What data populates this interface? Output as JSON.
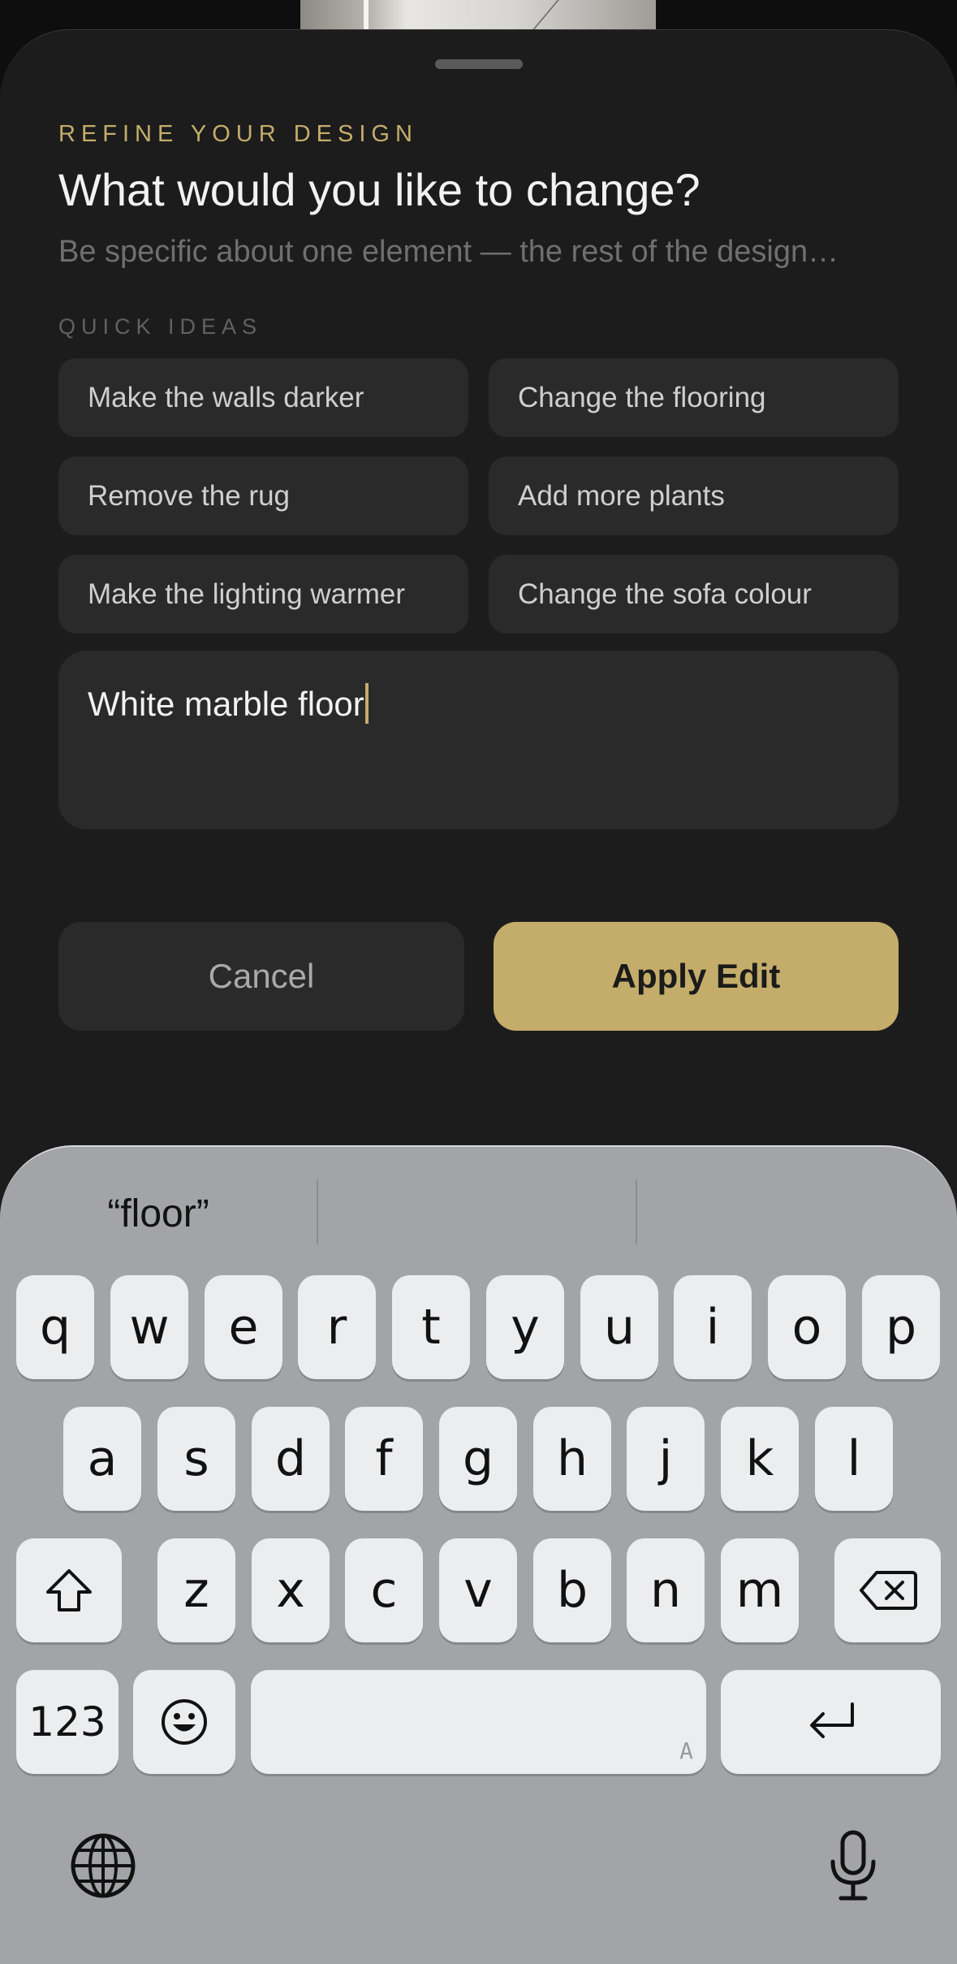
{
  "sheet": {
    "eyebrow": "REFINE YOUR DESIGN",
    "title": "What would you like to change?",
    "subtitle": "Be specific about one element — the rest of the design…",
    "quick_ideas_label": "QUICK IDEAS",
    "quick_ideas": [
      "Make the walls darker",
      "Change the flooring",
      "Remove the rug",
      "Add more plants",
      "Make the lighting warmer",
      "Change the sofa colour"
    ],
    "input_value": "White marble floor",
    "cancel_label": "Cancel",
    "apply_label": "Apply Edit"
  },
  "keyboard": {
    "suggestions": [
      "“floor”",
      "",
      ""
    ],
    "row1": [
      "q",
      "w",
      "e",
      "r",
      "t",
      "y",
      "u",
      "i",
      "o",
      "p"
    ],
    "row2": [
      "a",
      "s",
      "d",
      "f",
      "g",
      "h",
      "j",
      "k",
      "l"
    ],
    "row3": [
      "z",
      "x",
      "c",
      "v",
      "b",
      "n",
      "m"
    ],
    "numbers_label": "123",
    "space_hint": "A"
  },
  "colors": {
    "accent": "#c4ad6a",
    "sheet_bg": "#1c1c1c",
    "chip_bg": "#2a2a2a",
    "keyboard_bg": "#a3a4a7"
  },
  "icons": {
    "shift": "shift-icon",
    "backspace": "backspace-icon",
    "emoji": "emoji-icon",
    "return": "return-icon",
    "globe": "globe-icon",
    "microphone": "microphone-icon"
  }
}
